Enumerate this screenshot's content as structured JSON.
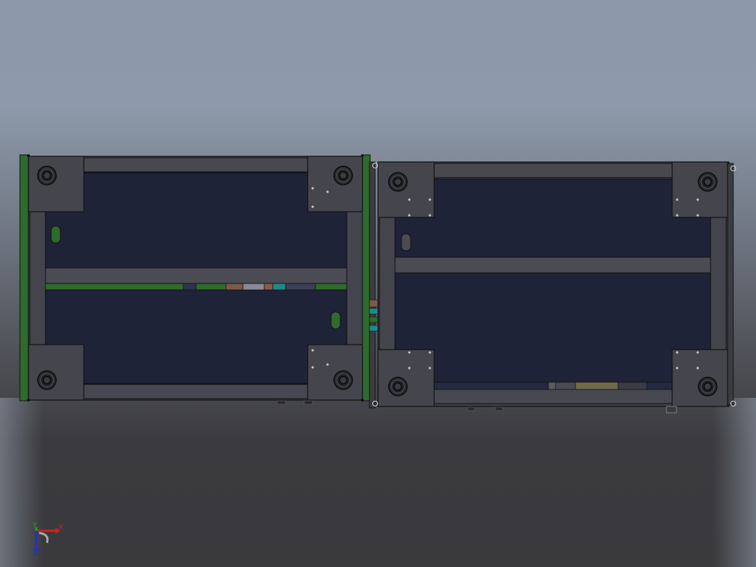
{
  "view": {
    "background_top": "#8d9aab",
    "background_bottom": "#3a3a3d",
    "panel_fill": "#1f2337",
    "frame_fill": "#3f4047",
    "corner_plate_fill": "#45464d",
    "rail_green": "#2f6b2c"
  },
  "triad": {
    "x_label": "X",
    "y_label": "Y",
    "z_label": "Z",
    "x_color": "#d32020",
    "y_color": "#1fa51f",
    "z_color": "#2030c8"
  },
  "icons": [
    "caster-wheel-icon",
    "mounting-hole-icon",
    "coordinate-triad-icon"
  ]
}
